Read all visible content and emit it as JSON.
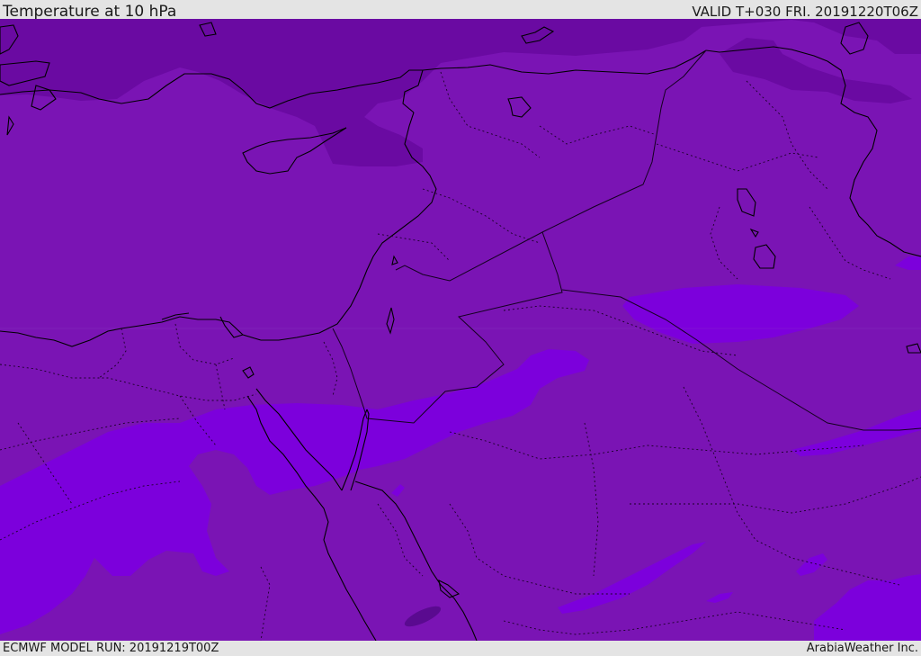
{
  "header": {
    "title": "Temperature at 10 hPa",
    "valid_time": "VALID T+030 FRI. 20191220T06Z"
  },
  "footer": {
    "model_run": "ECMWF MODEL RUN: 20191219T00Z",
    "credit": "ArabiaWeather Inc."
  },
  "map": {
    "colors": {
      "base": "#7a14b4",
      "cold": "#6a0aa2",
      "warm": "#7c00dc",
      "coastline": "#000000",
      "border": "#1a0026"
    }
  }
}
